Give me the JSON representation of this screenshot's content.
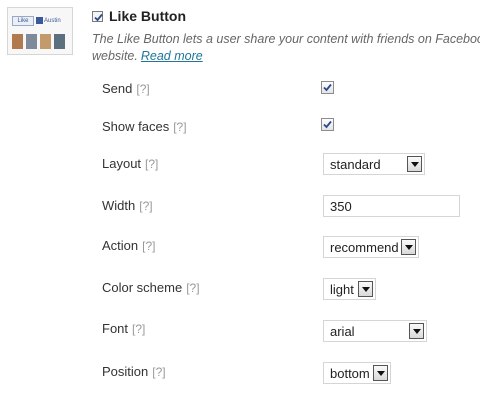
{
  "plugin": {
    "title": "Like Button",
    "enabled": true,
    "description": "The Like Button lets a user share your content with friends on Facebook",
    "description_cont": "website.",
    "read_more": "Read more",
    "thumbnail": {
      "like_text": "Like",
      "name_text": "Austin"
    }
  },
  "help_marker": "[?]",
  "fields": {
    "send": {
      "label": "Send",
      "checked": true
    },
    "show_faces": {
      "label": "Show faces",
      "checked": true
    },
    "layout": {
      "label": "Layout",
      "value": "standard"
    },
    "width": {
      "label": "Width",
      "value": "350"
    },
    "action": {
      "label": "Action",
      "value": "recommend"
    },
    "color_scheme": {
      "label": "Color scheme",
      "value": "light"
    },
    "font": {
      "label": "Font",
      "value": "arial"
    },
    "position": {
      "label": "Position",
      "value": "bottom"
    }
  },
  "colors": {
    "link": "#21759b",
    "facebook_blue": "#3b5998"
  }
}
